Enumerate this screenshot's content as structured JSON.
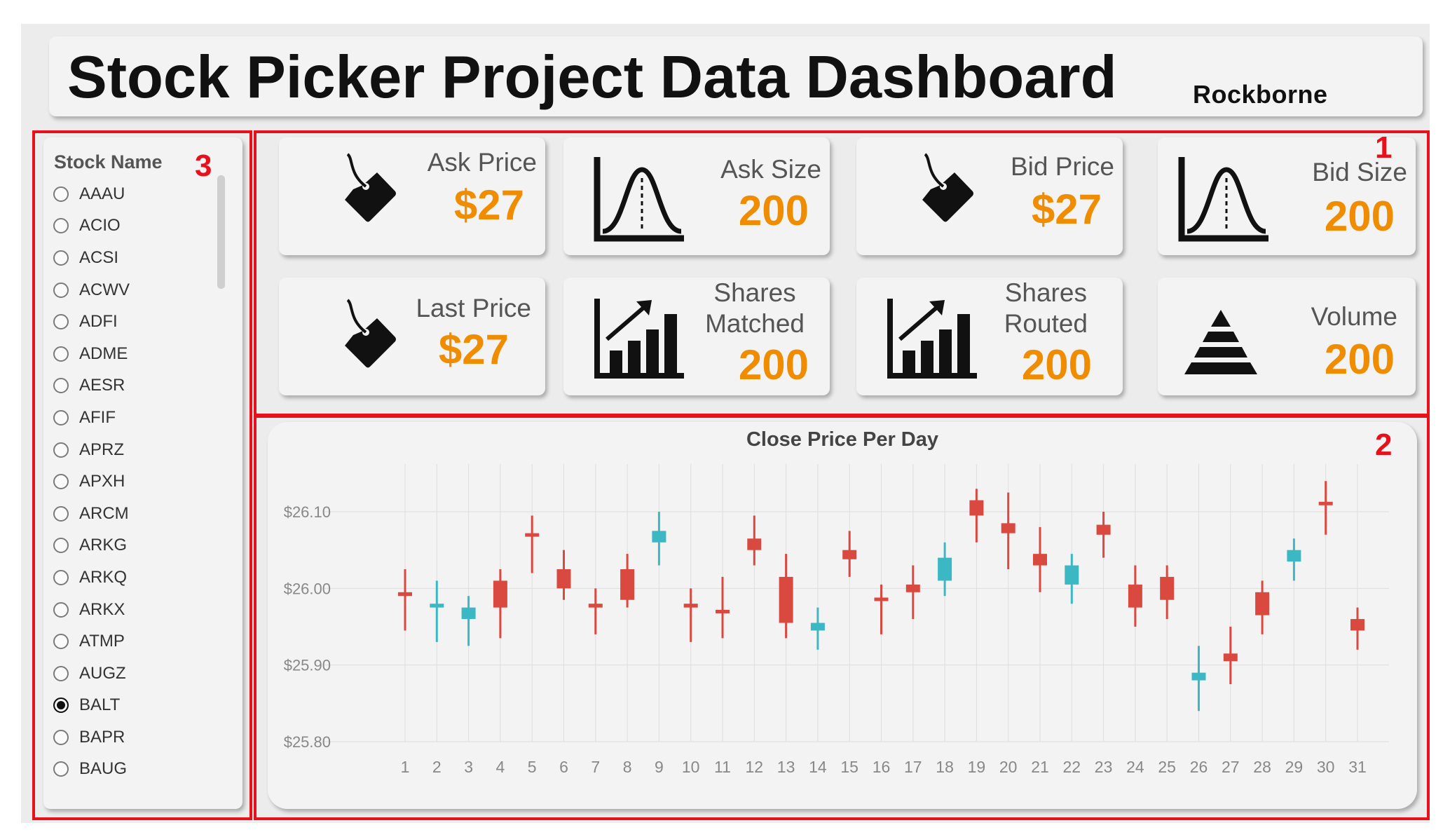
{
  "header": {
    "title": "Stock Picker Project Data Dashboard",
    "logo": "Rockborne"
  },
  "slicer": {
    "title": "Stock Name",
    "items": [
      "AAAU",
      "ACIO",
      "ACSI",
      "ACWV",
      "ADFI",
      "ADME",
      "AESR",
      "AFIF",
      "APRZ",
      "APXH",
      "ARCM",
      "ARKG",
      "ARKQ",
      "ARKX",
      "ATMP",
      "AUGZ",
      "BALT",
      "BAPR",
      "BAUG"
    ],
    "selected": "BALT"
  },
  "kpis": [
    {
      "label": "Ask Price",
      "value": "$27",
      "icon": "price-tag-icon"
    },
    {
      "label": "Ask Size",
      "value": "200",
      "icon": "bell-curve-icon"
    },
    {
      "label": "Bid Price",
      "value": "$27",
      "icon": "price-tag-icon"
    },
    {
      "label": "Bid Size",
      "value": "200",
      "icon": "bell-curve-icon"
    },
    {
      "label": "Last Price",
      "value": "$27",
      "icon": "price-tag-icon"
    },
    {
      "label_lines": [
        "Shares",
        "Matched"
      ],
      "value": "200",
      "icon": "bar-chart-growth-icon"
    },
    {
      "label_lines": [
        "Shares",
        "Routed"
      ],
      "value": "200",
      "icon": "bar-chart-growth-icon"
    },
    {
      "label": "Volume",
      "value": "200",
      "icon": "pyramid-icon"
    }
  ],
  "annotations": [
    "1",
    "2",
    "3"
  ],
  "colors": {
    "accent": "#f08c00",
    "candle_up": "#3cb8c4",
    "candle_down": "#d9493f",
    "annotation": "#e8101a"
  },
  "chart_data": {
    "type": "candlestick",
    "title": "Close Price Per Day",
    "xlabel": "",
    "ylabel": "",
    "x": [
      1,
      2,
      3,
      4,
      5,
      6,
      7,
      8,
      9,
      10,
      11,
      12,
      13,
      14,
      15,
      16,
      17,
      18,
      19,
      20,
      21,
      22,
      23,
      24,
      25,
      26,
      27,
      28,
      29,
      30,
      31
    ],
    "y_ticks": [
      "$25.80",
      "$25.90",
      "$26.00",
      "$26.10"
    ],
    "ylim": [
      25.8,
      26.1
    ],
    "grid": true,
    "candles": [
      {
        "day": 1,
        "open": 25.995,
        "close": 25.99,
        "high": 26.025,
        "low": 25.945
      },
      {
        "day": 2,
        "open": 25.975,
        "close": 25.98,
        "high": 26.01,
        "low": 25.93
      },
      {
        "day": 3,
        "open": 25.96,
        "close": 25.975,
        "high": 25.99,
        "low": 25.925
      },
      {
        "day": 4,
        "open": 26.01,
        "close": 25.975,
        "high": 26.025,
        "low": 25.935
      },
      {
        "day": 5,
        "open": 26.072,
        "close": 26.068,
        "high": 26.095,
        "low": 26.02
      },
      {
        "day": 6,
        "open": 26.025,
        "close": 26.0,
        "high": 26.05,
        "low": 25.985
      },
      {
        "day": 7,
        "open": 25.98,
        "close": 25.975,
        "high": 26.0,
        "low": 25.94
      },
      {
        "day": 8,
        "open": 26.025,
        "close": 25.985,
        "high": 26.045,
        "low": 25.975
      },
      {
        "day": 9,
        "open": 26.06,
        "close": 26.075,
        "high": 26.1,
        "low": 26.03
      },
      {
        "day": 10,
        "open": 25.98,
        "close": 25.975,
        "high": 26.0,
        "low": 25.93
      },
      {
        "day": 11,
        "open": 25.972,
        "close": 25.968,
        "high": 26.015,
        "low": 25.935
      },
      {
        "day": 12,
        "open": 26.065,
        "close": 26.05,
        "high": 26.095,
        "low": 26.03
      },
      {
        "day": 13,
        "open": 26.015,
        "close": 25.955,
        "high": 26.045,
        "low": 25.935
      },
      {
        "day": 14,
        "open": 25.945,
        "close": 25.955,
        "high": 25.975,
        "low": 25.92
      },
      {
        "day": 15,
        "open": 26.05,
        "close": 26.038,
        "high": 26.075,
        "low": 26.015
      },
      {
        "day": 16,
        "open": 25.988,
        "close": 25.984,
        "high": 26.005,
        "low": 25.94
      },
      {
        "day": 17,
        "open": 26.005,
        "close": 25.995,
        "high": 26.03,
        "low": 25.96
      },
      {
        "day": 18,
        "open": 26.01,
        "close": 26.04,
        "high": 26.06,
        "low": 25.99
      },
      {
        "day": 19,
        "open": 26.115,
        "close": 26.095,
        "high": 26.13,
        "low": 26.06
      },
      {
        "day": 20,
        "open": 26.085,
        "close": 26.072,
        "high": 26.125,
        "low": 26.025
      },
      {
        "day": 21,
        "open": 26.045,
        "close": 26.03,
        "high": 26.08,
        "low": 25.995
      },
      {
        "day": 22,
        "open": 26.005,
        "close": 26.03,
        "high": 26.045,
        "low": 25.98
      },
      {
        "day": 23,
        "open": 26.083,
        "close": 26.07,
        "high": 26.1,
        "low": 26.04
      },
      {
        "day": 24,
        "open": 26.005,
        "close": 25.975,
        "high": 26.03,
        "low": 25.95
      },
      {
        "day": 25,
        "open": 26.015,
        "close": 25.985,
        "high": 26.03,
        "low": 25.96
      },
      {
        "day": 26,
        "open": 25.88,
        "close": 25.89,
        "high": 25.925,
        "low": 25.84
      },
      {
        "day": 27,
        "open": 25.915,
        "close": 25.905,
        "high": 25.95,
        "low": 25.875
      },
      {
        "day": 28,
        "open": 25.995,
        "close": 25.965,
        "high": 26.01,
        "low": 25.94
      },
      {
        "day": 29,
        "open": 26.035,
        "close": 26.05,
        "high": 26.065,
        "low": 26.01
      },
      {
        "day": 30,
        "open": 26.113,
        "close": 26.109,
        "high": 26.14,
        "low": 26.07
      },
      {
        "day": 31,
        "open": 25.96,
        "close": 25.945,
        "high": 25.975,
        "low": 25.92
      }
    ]
  }
}
